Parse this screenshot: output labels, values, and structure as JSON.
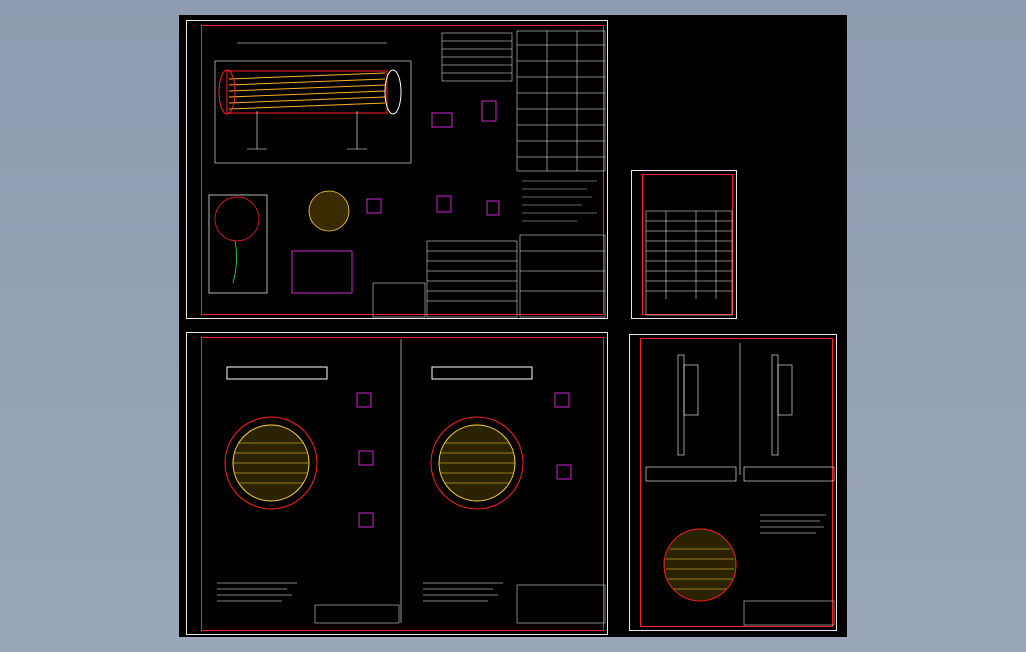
{
  "viewport": {
    "background": "#000000"
  },
  "colors": {
    "frame": "#ff2020",
    "sheet_border": "#e8e8e8",
    "geometry": "#ffffff",
    "hatch": "#ffd83a",
    "dimension": "#ff4040",
    "accent_magenta": "#ff30ff",
    "accent_green": "#30ff60",
    "tube": "#ffb020"
  },
  "sheets": [
    {
      "name": "sheet-assembly"
    },
    {
      "name": "sheet-parts-list"
    },
    {
      "name": "sheet-tubesheets"
    },
    {
      "name": "sheet-baffles"
    }
  ]
}
